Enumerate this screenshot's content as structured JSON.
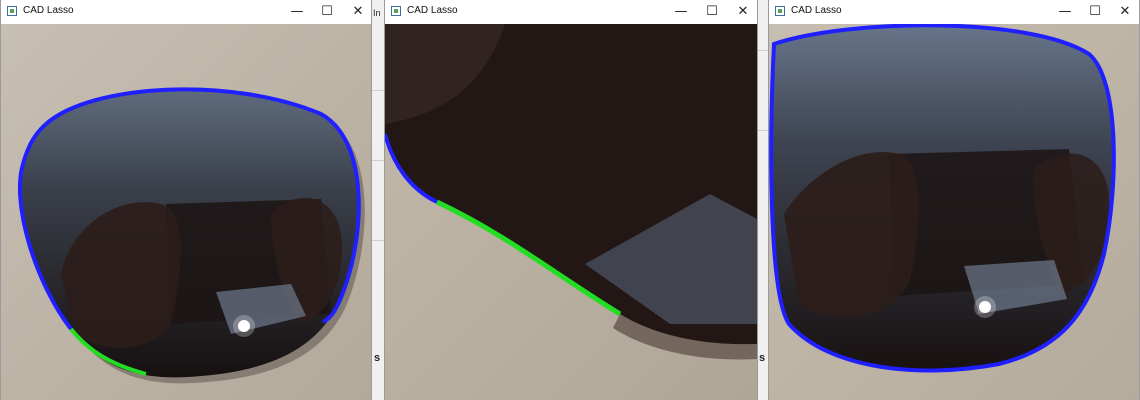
{
  "windows": [
    {
      "title": "CAD Lasso",
      "controls": {
        "minimize": "—",
        "maximize": "☐",
        "close": "✕"
      }
    },
    {
      "title": "CAD Lasso",
      "controls": {
        "minimize": "—",
        "maximize": "☐",
        "close": "✕"
      }
    },
    {
      "title": "CAD Lasso",
      "controls": {
        "minimize": "—",
        "maximize": "☐",
        "close": "✕"
      }
    }
  ],
  "background_strip": {
    "letter_top": "In",
    "letter_bottom": "s"
  },
  "colors": {
    "contour_blue": "#1f1fff",
    "contour_green": "#22dd22",
    "lens_dark": "#1c1414",
    "table": "#bdb4a6"
  }
}
